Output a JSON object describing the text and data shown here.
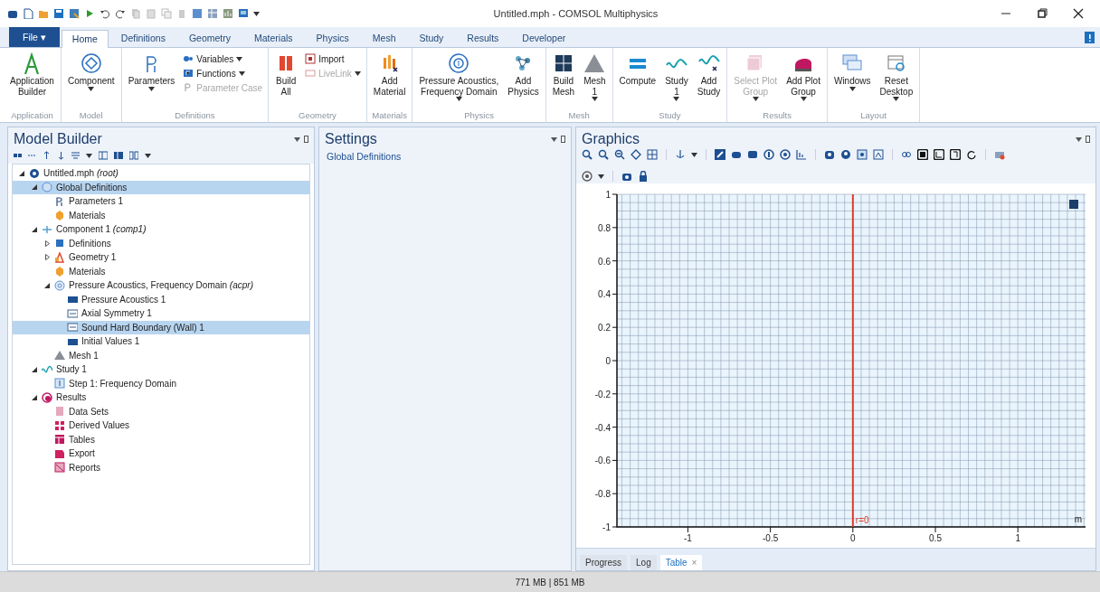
{
  "window": {
    "title": "Untitled.mph - COMSOL Multiphysics"
  },
  "ribbon_tabs": [
    {
      "label": "File ▾",
      "kind": "file",
      "selected": false
    },
    {
      "label": "Home",
      "kind": "tab",
      "selected": true
    },
    {
      "label": "Definitions",
      "kind": "tab",
      "selected": false
    },
    {
      "label": "Geometry",
      "kind": "tab",
      "selected": false
    },
    {
      "label": "Materials",
      "kind": "tab",
      "selected": false
    },
    {
      "label": "Physics",
      "kind": "tab",
      "selected": false
    },
    {
      "label": "Mesh",
      "kind": "tab",
      "selected": false
    },
    {
      "label": "Study",
      "kind": "tab",
      "selected": false
    },
    {
      "label": "Results",
      "kind": "tab",
      "selected": false
    },
    {
      "label": "Developer",
      "kind": "tab",
      "selected": false
    }
  ],
  "ribbon": {
    "groups": [
      {
        "label": "Application",
        "items": [
          {
            "kind": "large",
            "label": "Application\nBuilder",
            "menu": false,
            "disabled": false
          }
        ]
      },
      {
        "label": "Model",
        "items": [
          {
            "kind": "large",
            "label": "Component",
            "menu": true,
            "disabled": false
          }
        ]
      },
      {
        "label": "Definitions",
        "items": [
          {
            "kind": "large",
            "label": "Parameters",
            "menu": true,
            "disabled": false
          },
          {
            "kind": "small",
            "label": "Variables",
            "menu": true,
            "disabled": false
          },
          {
            "kind": "small",
            "label": "Functions",
            "menu": true,
            "disabled": false
          },
          {
            "kind": "small",
            "label": "Parameter Case",
            "menu": false,
            "disabled": true
          }
        ]
      },
      {
        "label": "Geometry",
        "items": [
          {
            "kind": "large",
            "label": "Build\nAll",
            "menu": false,
            "disabled": false
          },
          {
            "kind": "small",
            "label": "Import",
            "menu": false,
            "disabled": false
          },
          {
            "kind": "small",
            "label": "LiveLink",
            "menu": true,
            "disabled": true
          }
        ]
      },
      {
        "label": "Materials",
        "items": [
          {
            "kind": "large",
            "label": "Add\nMaterial",
            "menu": false,
            "disabled": false
          }
        ]
      },
      {
        "label": "Physics",
        "items": [
          {
            "kind": "large",
            "label": "Pressure Acoustics,\nFrequency Domain",
            "menu": true,
            "disabled": false
          },
          {
            "kind": "large",
            "label": "Add\nPhysics",
            "menu": false,
            "disabled": false
          }
        ]
      },
      {
        "label": "Mesh",
        "items": [
          {
            "kind": "large",
            "label": "Build\nMesh",
            "menu": false,
            "disabled": false
          },
          {
            "kind": "large",
            "label": "Mesh\n1",
            "menu": true,
            "disabled": false
          }
        ]
      },
      {
        "label": "Study",
        "items": [
          {
            "kind": "large",
            "label": "Compute",
            "menu": false,
            "disabled": false
          },
          {
            "kind": "large",
            "label": "Study\n1",
            "menu": true,
            "disabled": false
          },
          {
            "kind": "large",
            "label": "Add\nStudy",
            "menu": false,
            "disabled": false
          }
        ]
      },
      {
        "label": "Results",
        "items": [
          {
            "kind": "large",
            "label": "Select Plot\nGroup",
            "menu": true,
            "disabled": true
          },
          {
            "kind": "large",
            "label": "Add Plot\nGroup",
            "menu": true,
            "disabled": false
          }
        ]
      },
      {
        "label": "Layout",
        "items": [
          {
            "kind": "large",
            "label": "Windows",
            "menu": true,
            "disabled": false
          },
          {
            "kind": "large",
            "label": "Reset\nDesktop",
            "menu": true,
            "disabled": false
          }
        ]
      }
    ]
  },
  "model_builder": {
    "title": "Model Builder",
    "tree": [
      {
        "label": "Untitled.mph *(root)*",
        "kind": "root",
        "expanded": true,
        "selected": false,
        "children": [
          {
            "label": "Global Definitions",
            "kind": "global",
            "expanded": true,
            "selected": true,
            "children": [
              {
                "label": "Parameters 1",
                "kind": "parameters",
                "selected": false
              },
              {
                "label": "Materials",
                "kind": "materials",
                "selected": false
              }
            ]
          },
          {
            "label": "Component 1 *(comp1)*",
            "kind": "component",
            "expanded": true,
            "selected": false,
            "children": [
              {
                "label": "Definitions",
                "kind": "definitions",
                "expanded": false,
                "selected": false
              },
              {
                "label": "Geometry 1",
                "kind": "geometry",
                "expanded": false,
                "selected": false
              },
              {
                "label": "Materials",
                "kind": "materials",
                "selected": false
              },
              {
                "label": "Pressure Acoustics, Frequency Domain *(acpr)*",
                "kind": "physics",
                "expanded": true,
                "selected": false,
                "children": [
                  {
                    "label": "Pressure Acoustics 1",
                    "kind": "feature",
                    "selected": false
                  },
                  {
                    "label": "Axial Symmetry 1",
                    "kind": "boundary",
                    "selected": false
                  },
                  {
                    "label": "Sound Hard Boundary (Wall) 1",
                    "kind": "boundary",
                    "selected": true
                  },
                  {
                    "label": "Initial Values 1",
                    "kind": "feature",
                    "selected": false
                  }
                ]
              },
              {
                "label": "Mesh 1",
                "kind": "mesh",
                "selected": false
              }
            ]
          },
          {
            "label": "Study 1",
            "kind": "study",
            "expanded": true,
            "selected": false,
            "children": [
              {
                "label": "Step 1: Frequency Domain",
                "kind": "step",
                "selected": false
              }
            ]
          },
          {
            "label": "Results",
            "kind": "results",
            "expanded": true,
            "selected": false,
            "children": [
              {
                "label": "Data Sets",
                "kind": "datasets",
                "selected": false
              },
              {
                "label": "Derived Values",
                "kind": "derived",
                "selected": false
              },
              {
                "label": "Tables",
                "kind": "tables",
                "selected": false
              },
              {
                "label": "Export",
                "kind": "export",
                "selected": false
              },
              {
                "label": "Reports",
                "kind": "reports",
                "selected": false
              }
            ]
          }
        ]
      }
    ]
  },
  "settings": {
    "title": "Settings",
    "subtitle": "Global Definitions"
  },
  "graphics": {
    "title": "Graphics",
    "chart_data": {
      "type": "line",
      "xlim": [
        -1.43,
        1.41
      ],
      "ylim": [
        -1,
        1
      ],
      "xticks": [
        -1,
        -0.5,
        0,
        0.5,
        1
      ],
      "yticks": [
        1,
        0.8,
        0.6,
        0.4,
        0.2,
        0,
        -0.2,
        -0.4,
        -0.6,
        -0.8,
        -1
      ],
      "grid": true,
      "ref_lines": [
        {
          "axis": "x",
          "value": 0,
          "label": "r=0"
        }
      ]
    },
    "unit": "m"
  },
  "bottom_tabs": [
    {
      "label": "Progress",
      "selected": false
    },
    {
      "label": "Log",
      "selected": false
    },
    {
      "label": "Table",
      "close": "×",
      "selected": true
    }
  ],
  "status_bar": {
    "text": "771 MB | 851 MB"
  }
}
